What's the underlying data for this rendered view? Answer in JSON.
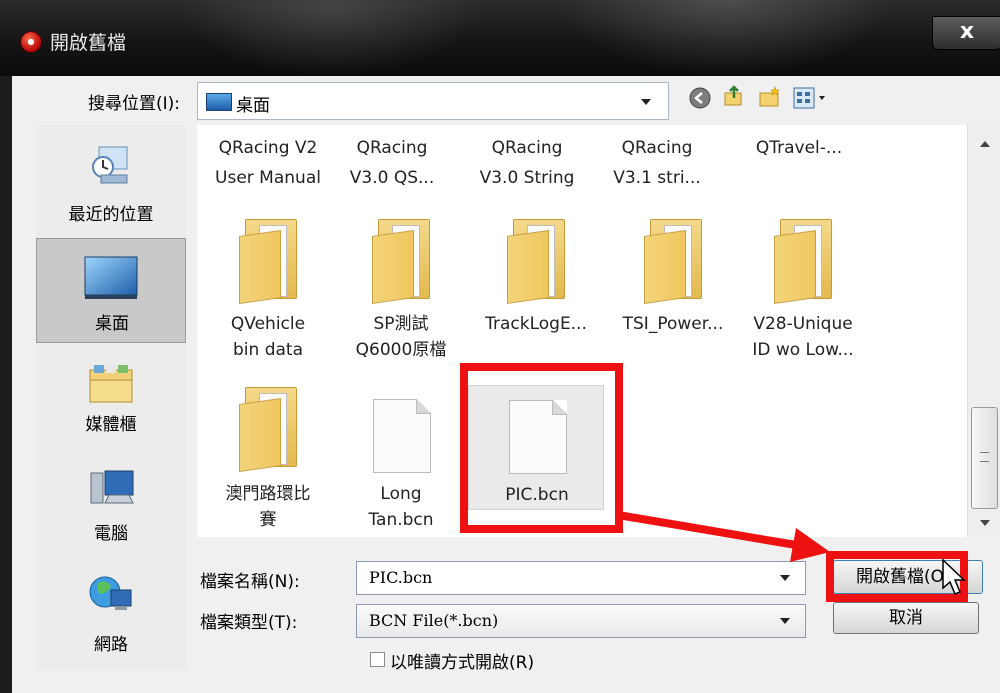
{
  "window": {
    "title": "開啟舊檔",
    "close_label": "x"
  },
  "toolbar": {
    "lookin_label": "搜尋位置(I):",
    "lookin_value": "桌面",
    "icons": [
      "back-icon",
      "up-folder-icon",
      "new-folder-icon",
      "view-menu-icon"
    ]
  },
  "places": [
    {
      "label": "最近的位置",
      "icon": "recent-places-icon"
    },
    {
      "label": "桌面",
      "icon": "desktop-icon",
      "selected": true
    },
    {
      "label": "媒體櫃",
      "icon": "libraries-icon"
    },
    {
      "label": "電腦",
      "icon": "computer-icon"
    },
    {
      "label": "網路",
      "icon": "network-icon"
    }
  ],
  "files": {
    "row1": [
      {
        "line1": "QRacing V2",
        "line2": "User Manual"
      },
      {
        "line1": "QRacing",
        "line2": "V3.0 QS..."
      },
      {
        "line1": "QRacing",
        "line2": "V3.0 String"
      },
      {
        "line1": "QRacing",
        "line2": "V3.1 stri..."
      },
      {
        "line1": "QTravel-...",
        "line2": ""
      }
    ],
    "row2": [
      {
        "line1": "QVehicle",
        "line2": "bin data",
        "icon": "folder-icon"
      },
      {
        "line1": "SP測試",
        "line2": "Q6000原檔",
        "icon": "folder-icon"
      },
      {
        "line1": "TrackLogE...",
        "line2": "",
        "icon": "folder-icon"
      },
      {
        "line1": "TSI_Power...",
        "line2": "",
        "icon": "folder-icon"
      },
      {
        "line1": "V28-Unique",
        "line2": "ID wo Low...",
        "icon": "folder-icon"
      }
    ],
    "row3": [
      {
        "line1": "澳門路環比",
        "line2": "賽",
        "icon": "folder-icon"
      },
      {
        "line1": "Long",
        "line2": "Tan.bcn",
        "icon": "document-icon"
      },
      {
        "line1": "PIC.bcn",
        "line2": "",
        "icon": "document-icon",
        "selected": true
      }
    ]
  },
  "bottom": {
    "filename_label": "檔案名稱(N):",
    "filename_value": "PIC.bcn",
    "filetype_label": "檔案類型(T):",
    "filetype_value": "BCN File(*.bcn)",
    "readonly_label": "以唯讀方式開啟(R)",
    "open_button": "開啟舊檔(O",
    "cancel_button": "取消"
  },
  "colors": {
    "annotation": "#ee1111",
    "titlebar": "#151515",
    "dialog_bg": "#f0f0f0"
  }
}
